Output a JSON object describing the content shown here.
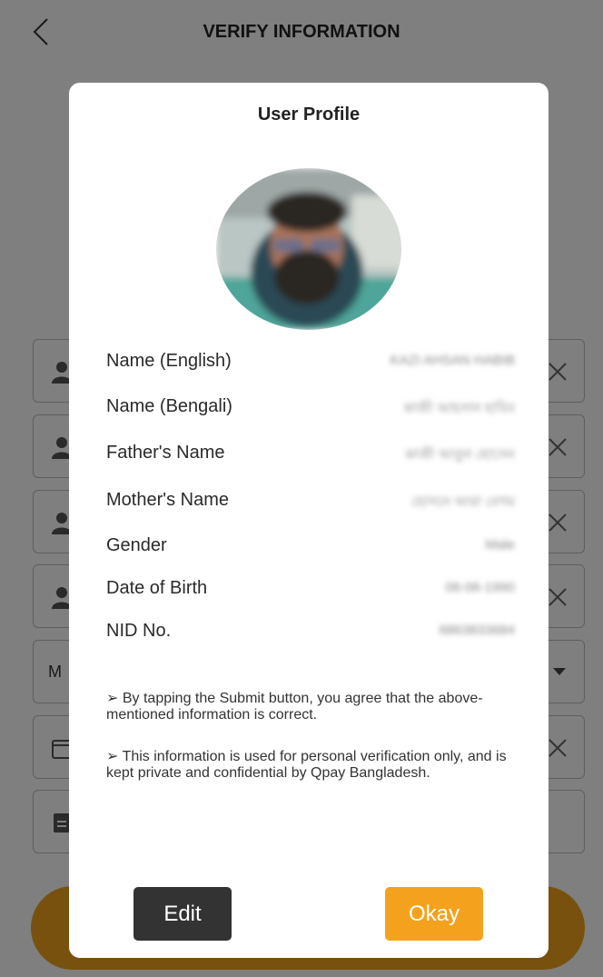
{
  "header": {
    "title": "VERIFY INFORMATION"
  },
  "background": {
    "dropdown_partial_label": "M",
    "colors": {
      "accent": "#f0a21e"
    }
  },
  "modal": {
    "title": "User Profile",
    "fields": [
      {
        "label": "Name (English)",
        "value": "KAZI AHSAN HABIB"
      },
      {
        "label": "Name (Bengali)",
        "value": "কাজী আহসান হাবিব"
      },
      {
        "label": "Father's Name",
        "value": "কাজী আবুল হোসেন"
      },
      {
        "label": "Mother's Name",
        "value": "হোসনে আরা বেগম"
      },
      {
        "label": "Gender",
        "value": "Male"
      },
      {
        "label": "Date of Birth",
        "value": "06-06-1990"
      },
      {
        "label": "NID No.",
        "value": "6863833684"
      }
    ],
    "notes": [
      "➢ By tapping the Submit button, you agree that the above-mentioned information is correct.",
      "➢ This information is used for personal verification only, and is kept private and confidential by Qpay Bangladesh."
    ],
    "edit_label": "Edit",
    "okay_label": "Okay",
    "colors": {
      "edit_bg": "#333333",
      "okay_bg": "#f4a21d"
    }
  }
}
